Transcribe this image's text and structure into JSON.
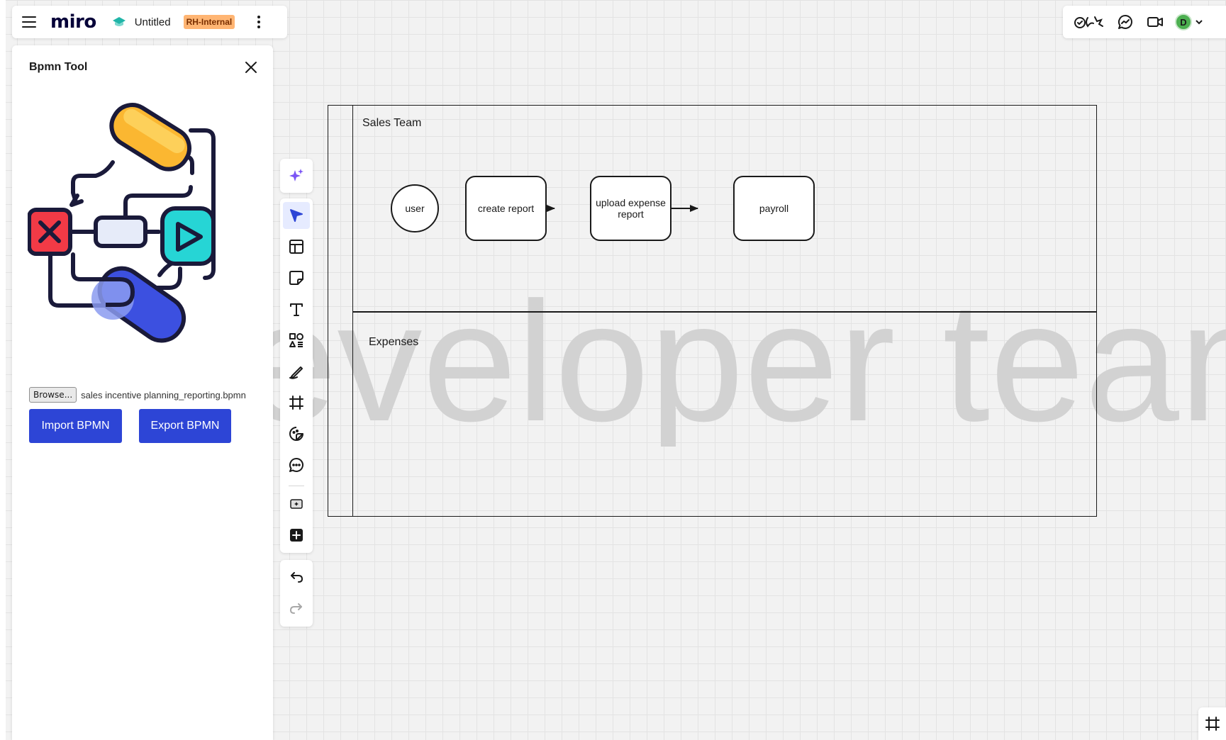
{
  "app": {
    "logo_text": "miro",
    "board_title": "Untitled",
    "badge": "RH-Internal",
    "accent_color": "#2d45d6"
  },
  "panel": {
    "title": "Bpmn Tool",
    "browse_label": "Browse...",
    "file_name": "sales incentive planning_reporting.bpmn",
    "import_label": "Import BPMN",
    "export_label": "Export BPMN"
  },
  "toolbar": {
    "icons": [
      "ai-sparkle-icon",
      "select-cursor-icon",
      "templates-icon",
      "sticky-note-icon",
      "text-icon",
      "shapes-icon",
      "pen-icon",
      "frame-icon",
      "stickers-icon",
      "comment-icon",
      "embed-icon",
      "add-more-icon",
      "undo-icon",
      "redo-icon"
    ]
  },
  "topbar_right": {
    "avatar_initial": "D",
    "icons": [
      "reactions-icon",
      "chat-icon",
      "video-icon",
      "chevron-down-icon"
    ]
  },
  "canvas": {
    "watermark": "eveloper team",
    "lanes": [
      "Sales Team",
      "Expenses"
    ],
    "nodes": {
      "start": "user",
      "task1": "create report",
      "task2": "upload expense report",
      "task3": "payroll"
    }
  }
}
